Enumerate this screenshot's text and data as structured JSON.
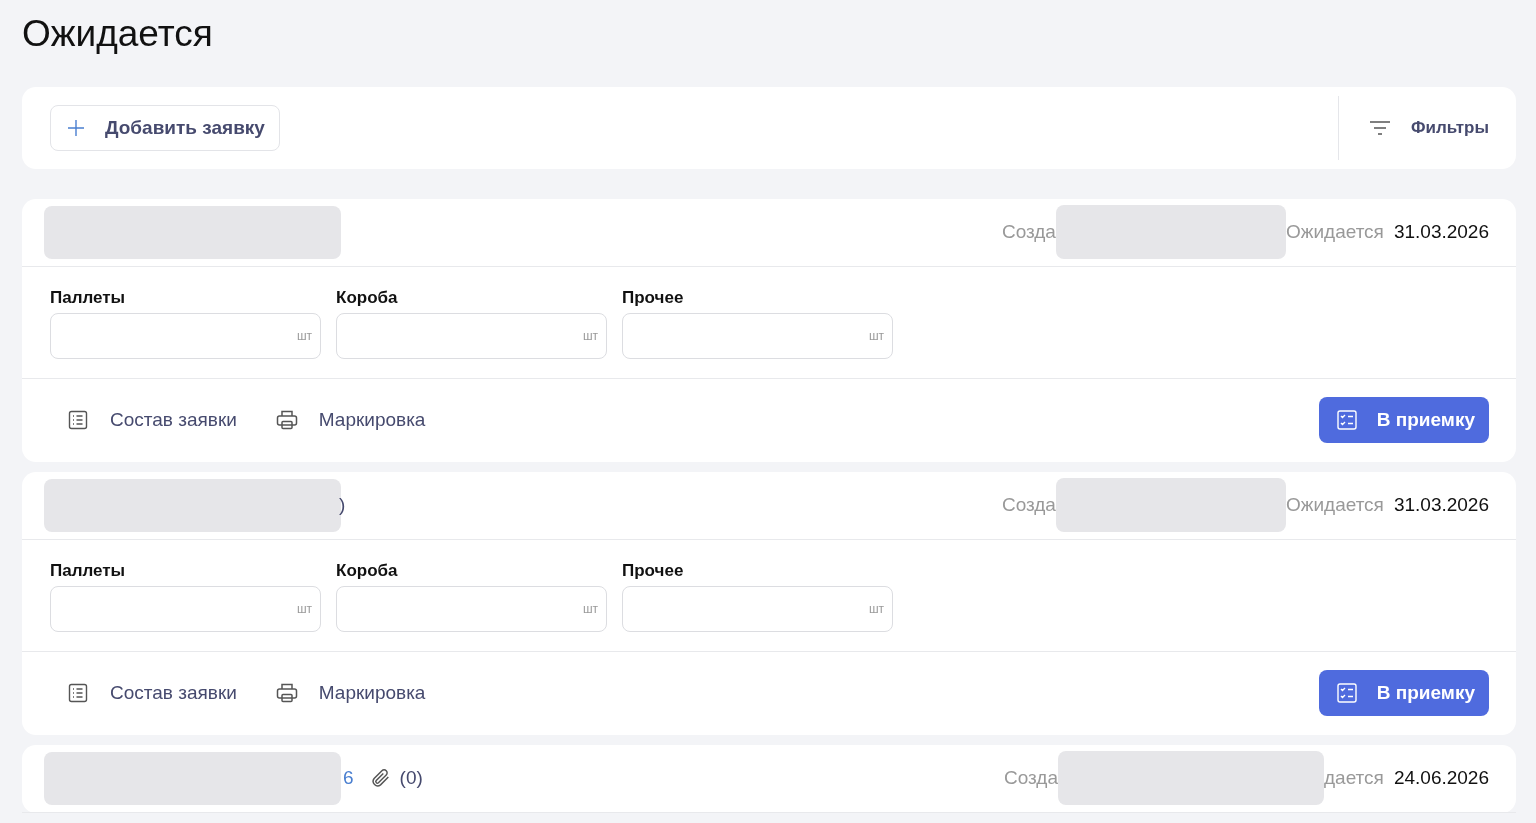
{
  "page_title": "Ожидается",
  "toolbar": {
    "add_button": "Добавить заявку",
    "filters_button": "Фильтры"
  },
  "orders": [
    {
      "created_label": "Созда",
      "expected_label": "Ожидается",
      "expected_date": "31.03.2026",
      "fields": [
        {
          "label": "Паллеты",
          "unit": "шт"
        },
        {
          "label": "Короба",
          "unit": "шт"
        },
        {
          "label": "Прочее",
          "unit": "шт"
        }
      ],
      "actions": [
        {
          "kind": "list",
          "label": "Состав заявки"
        },
        {
          "kind": "print",
          "label": "Маркировка"
        }
      ],
      "accept_button": "В приемку"
    },
    {
      "header_tail": ")",
      "created_label": "Созда",
      "expected_label": "Ожидается",
      "expected_date": "31.03.2026",
      "fields": [
        {
          "label": "Паллеты",
          "unit": "шт"
        },
        {
          "label": "Короба",
          "unit": "шт"
        },
        {
          "label": "Прочее",
          "unit": "шт"
        }
      ],
      "actions": [
        {
          "kind": "list",
          "label": "Состав заявки"
        },
        {
          "kind": "print",
          "label": "Маркировка"
        }
      ],
      "accept_button": "В приемку"
    },
    {
      "number_tail": "6",
      "attachments": "(0)",
      "created_label": "Созда",
      "expected_label": "дается",
      "expected_date": "24.06.2026"
    }
  ]
}
